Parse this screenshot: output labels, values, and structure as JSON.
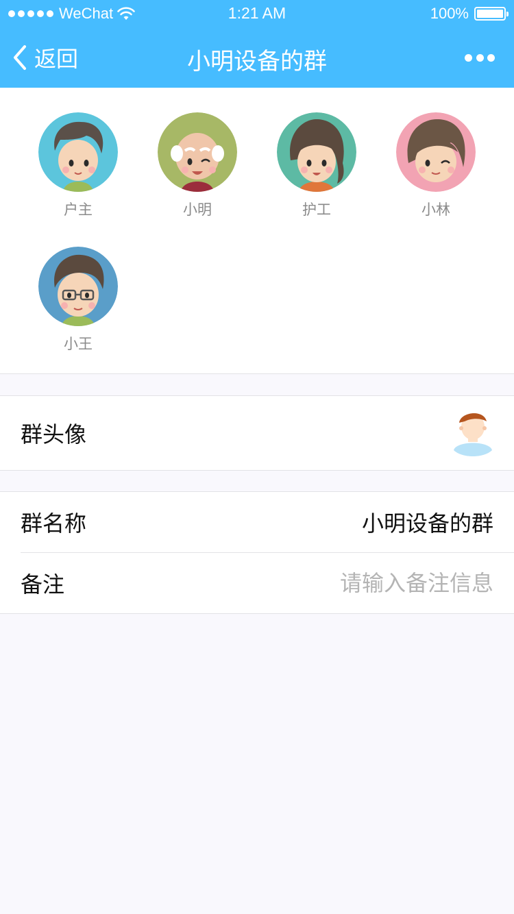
{
  "status_bar": {
    "carrier": "WeChat",
    "time": "1:21 AM",
    "battery": "100%"
  },
  "nav": {
    "back_label": "返回",
    "title": "小明设备的群"
  },
  "members": [
    {
      "name": "户主",
      "ring": "#5cc5dc"
    },
    {
      "name": "小明",
      "ring": "#a7b866"
    },
    {
      "name": "护工",
      "ring": "#5dbaa4"
    },
    {
      "name": "小林",
      "ring": "#f2a3b3"
    },
    {
      "name": "小王",
      "ring": "#5a9ec9"
    }
  ],
  "settings": {
    "group_avatar_label": "群头像",
    "group_name_label": "群名称",
    "group_name_value": "小明设备的群",
    "remark_label": "备注",
    "remark_placeholder": "请输入备注信息"
  },
  "colors": {
    "header": "#46bcff",
    "background": "#f9f8fd"
  }
}
